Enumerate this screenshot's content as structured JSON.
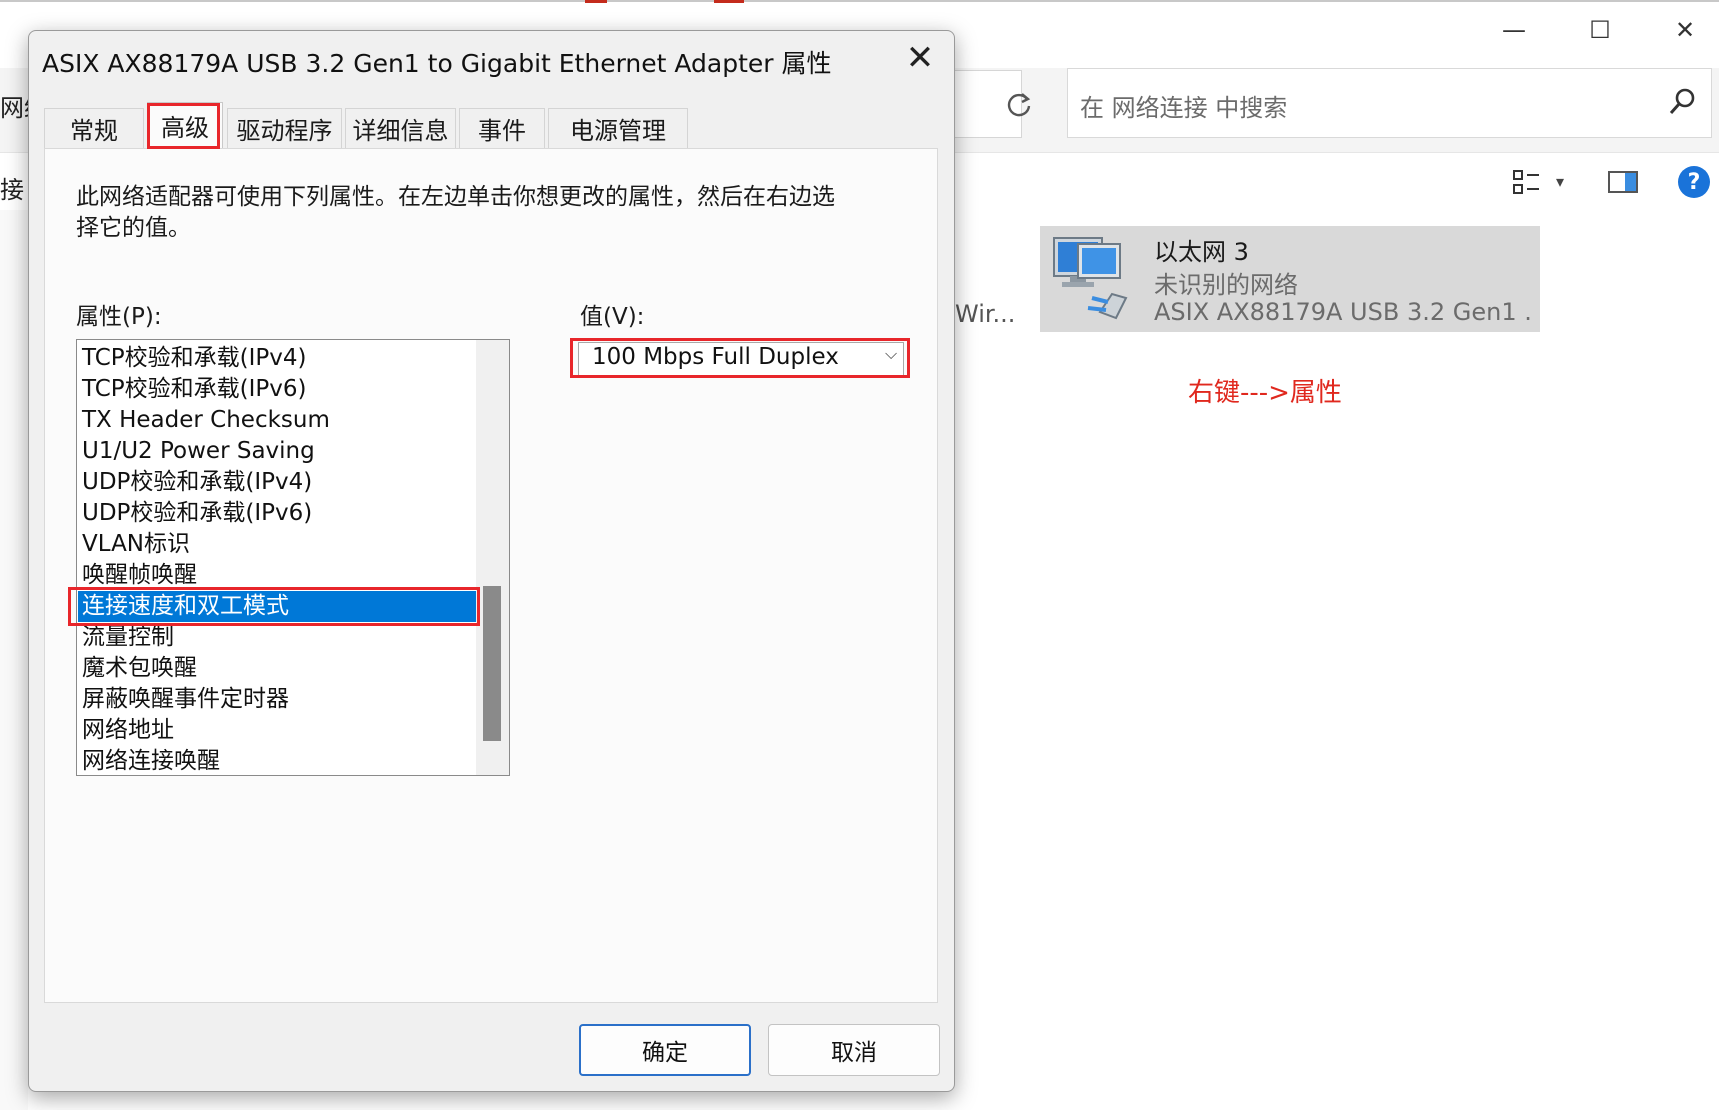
{
  "explorer": {
    "nav_fragment_top": "网络",
    "nav_fragment_side": "接",
    "search_placeholder": "在 网络连接 中搜索",
    "window_controls": {
      "minimize": "—",
      "maximize": "☐",
      "close": "✕"
    },
    "partial_item_label": "Wir...",
    "adapter": {
      "name": "以太网 3",
      "status": "未识别的网络",
      "device": "ASIX AX88179A USB 3.2 Gen1 ..."
    },
    "icons": [
      "refresh-icon",
      "search-icon",
      "view-options-icon",
      "preview-pane-icon",
      "help-icon",
      "network-adapter-icon"
    ],
    "help_label": "?"
  },
  "annotation": {
    "note": "右键--->属性",
    "highlight_color": "#e8262b"
  },
  "dialog": {
    "title": "ASIX AX88179A USB 3.2 Gen1 to Gigabit Ethernet Adapter 属性",
    "tabs": [
      {
        "label": "常规",
        "active": false
      },
      {
        "label": "高级",
        "active": true
      },
      {
        "label": "驱动程序",
        "active": false
      },
      {
        "label": "详细信息",
        "active": false
      },
      {
        "label": "事件",
        "active": false
      },
      {
        "label": "电源管理",
        "active": false
      }
    ],
    "description": "此网络适配器可使用下列属性。在左边单击你想更改的属性，然后在右边选择它的值。",
    "property_label": "属性(P):",
    "value_label": "值(V):",
    "properties": [
      "TCP校验和承载(IPv4)",
      "TCP校验和承载(IPv6)",
      "TX Header Checksum",
      "U1/U2 Power Saving",
      "UDP校验和承载(IPv4)",
      "UDP校验和承载(IPv6)",
      "VLAN标识",
      "唤醒帧唤醒",
      "连接速度和双工模式",
      "流量控制",
      "魔术包唤醒",
      "屏蔽唤醒事件定时器",
      "网络地址",
      "网络连接唤醒"
    ],
    "selected_property": "连接速度和双工模式",
    "value_selected": "100 Mbps Full Duplex",
    "ok_label": "确定",
    "cancel_label": "取消",
    "selection_color": "#0078d7"
  }
}
